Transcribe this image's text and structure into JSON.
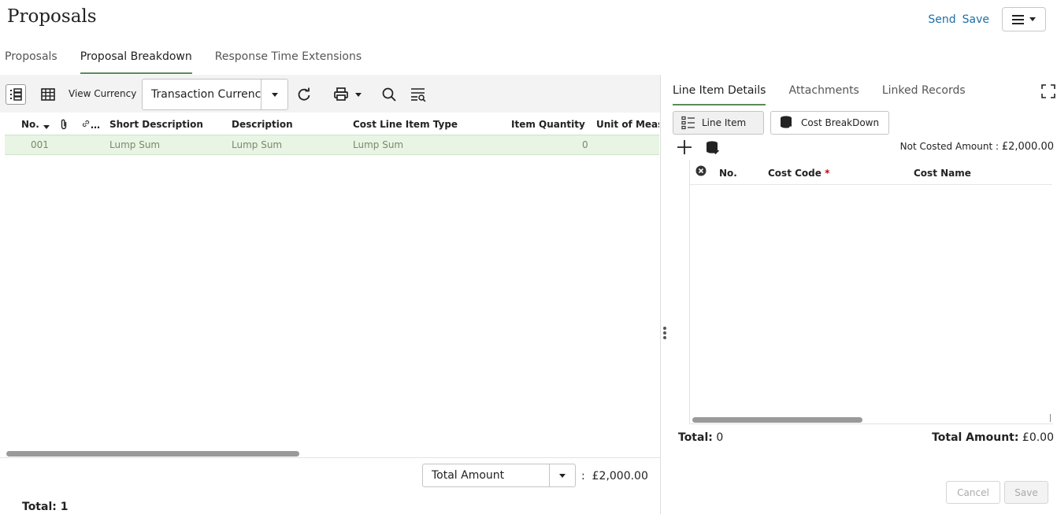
{
  "header": {
    "title": "Proposals",
    "send_label": "Send",
    "save_label": "Save"
  },
  "main_tabs": [
    {
      "label": "Proposals",
      "active": false
    },
    {
      "label": "Proposal Breakdown",
      "active": true
    },
    {
      "label": "Response Time Extensions",
      "active": false
    }
  ],
  "toolbar": {
    "view_currency_label": "View Currency",
    "currency_value": "Transaction Currenc",
    "icons": [
      "tree-view-icon",
      "table-view-icon",
      "refresh-icon",
      "print-icon",
      "search-icon",
      "filter-icon"
    ]
  },
  "grid": {
    "columns": [
      "No.",
      "",
      "…",
      "Short Description",
      "Description",
      "Cost Line Item Type",
      "Item Quantity",
      "Unit of Measu"
    ],
    "rows": [
      {
        "no": "001",
        "short_description": "Lump Sum",
        "description": "Lump Sum",
        "cost_line_item_type": "Lump Sum",
        "item_quantity": "0"
      }
    ]
  },
  "footer": {
    "total_select_value": "Total Amount",
    "separator": ":",
    "total_amount": "£2,000.00",
    "total_label": "Total: 1"
  },
  "right_panel": {
    "tabs": [
      {
        "label": "Line Item Details",
        "active": true
      },
      {
        "label": "Attachments",
        "active": false
      },
      {
        "label": "Linked Records",
        "active": false
      }
    ],
    "segments": {
      "line_item_label": "Line Item",
      "cost_breakdown_label": "Cost BreakDown"
    },
    "not_costed_label": "Not Costed Amount :",
    "not_costed_amount": "£2,000.00",
    "cost_grid": {
      "columns": [
        "No.",
        "Cost Code",
        "*",
        "Cost Name"
      ]
    },
    "total_label": "Total:",
    "total_value": "0",
    "total_amount_label": "Total Amount:",
    "total_amount_value": "£0.00",
    "cancel_label": "Cancel",
    "save_label": "Save"
  },
  "colors": {
    "link": "#1b6fa8",
    "selected_row": "#e8f4e4",
    "tab_underline": "#5a8a5a",
    "required": "#cc0000"
  }
}
